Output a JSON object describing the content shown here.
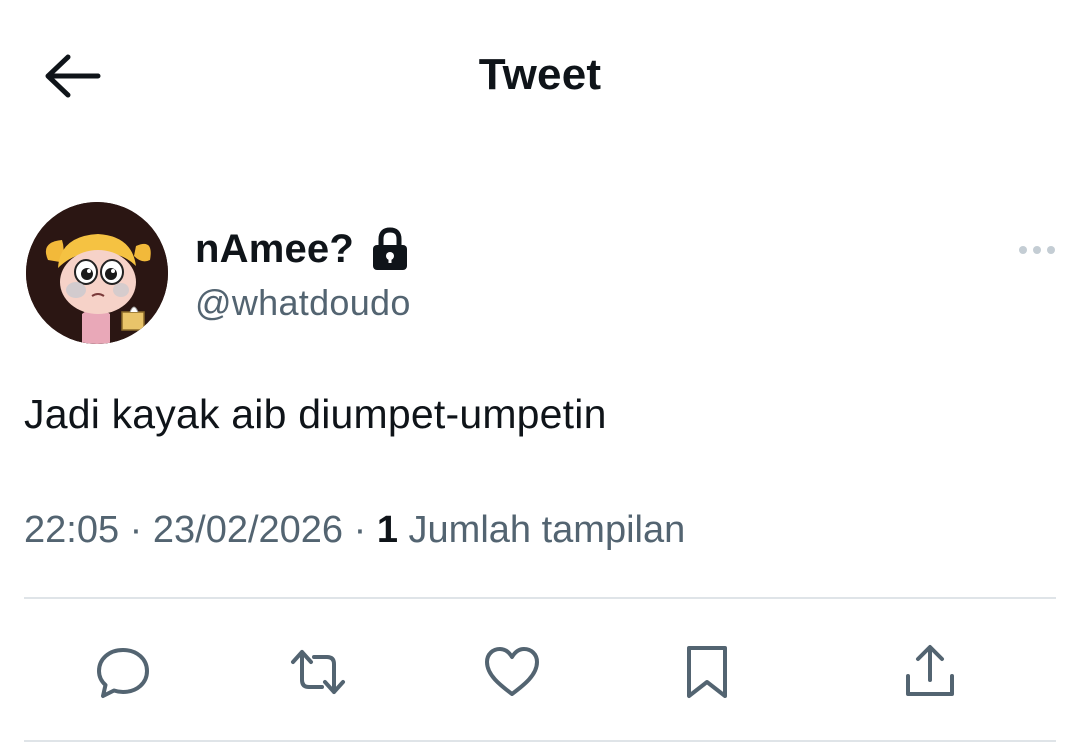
{
  "header": {
    "title": "Tweet",
    "back_icon": "arrow-left-icon"
  },
  "tweet": {
    "author": {
      "display_name": "nAmee?",
      "username": "@whatdoudo",
      "protected_icon": "lock-icon",
      "avatar": "cartoon-girl-avatar"
    },
    "text": "Jadi kayak aib diumpet-umpetin",
    "time": "22:05",
    "date": "23/02/2026",
    "separator": "·",
    "views_count": "1",
    "views_label": "Jumlah tampilan"
  },
  "actions": [
    {
      "name": "reply",
      "icon": "reply-icon"
    },
    {
      "name": "retweet",
      "icon": "retweet-icon"
    },
    {
      "name": "like",
      "icon": "heart-icon"
    },
    {
      "name": "bookmark",
      "icon": "bookmark-icon"
    },
    {
      "name": "share",
      "icon": "share-icon"
    }
  ],
  "colors": {
    "text_primary": "#0f1419",
    "text_secondary": "#536471",
    "divider": "#dfe4e8",
    "icon": "#536471"
  }
}
